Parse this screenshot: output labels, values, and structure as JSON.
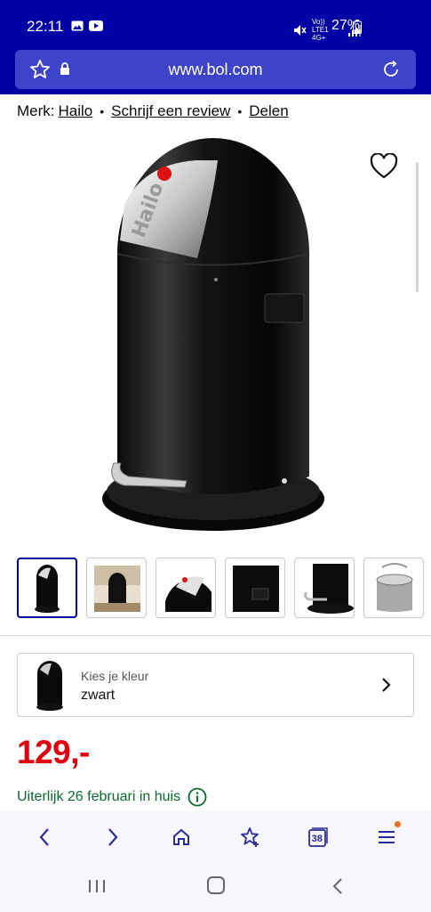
{
  "status": {
    "time": "22:11",
    "network": "Vo)) LTE1 4G+",
    "battery": "27%"
  },
  "browser": {
    "url": "www.bol.com",
    "tabs_count": "38"
  },
  "product": {
    "brand_label": "Merk:",
    "brand": "Hailo",
    "write_review": "Schrijf een review",
    "share": "Delen",
    "logo_text": "Hailo",
    "color_prompt": "Kies je kleur",
    "color_value": "zwart",
    "price": "129,-",
    "delivery": "Uiterlijk 26 februari in huis"
  },
  "colors": {
    "brand_blue": "#0000a4",
    "price_red": "#e1000f",
    "delivery_green": "#0a6b2b"
  },
  "icons": [
    "star-icon",
    "lock-icon",
    "reload-icon",
    "heart-icon",
    "chevron-right-icon",
    "info-icon",
    "back-icon",
    "forward-icon",
    "home-icon",
    "bookmarks-icon",
    "tabs-icon",
    "menu-icon"
  ]
}
